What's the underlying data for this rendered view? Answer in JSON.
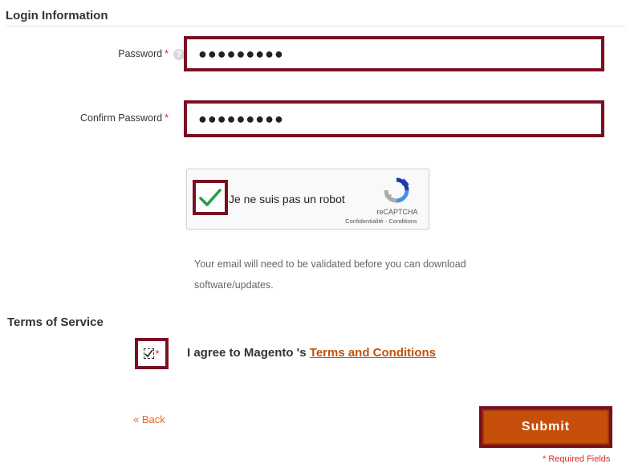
{
  "login": {
    "title": "Login Information",
    "password_label": "Password",
    "password_value": "●●●●●●●●●",
    "confirm_label": "Confirm Password",
    "confirm_value": "●●●●●●●●●",
    "required_star": "*",
    "help_glyph": "?"
  },
  "captcha": {
    "label": "Je ne suis pas un robot",
    "brand": "reCAPTCHA",
    "links": "Confidentialité - Conditions",
    "checked": true
  },
  "note": {
    "line1": "Your email will need to be validated before you can download",
    "line2": "software/updates."
  },
  "terms": {
    "title": "Terms of Service",
    "agree_prefix": "I agree to Magento 's ",
    "link_text": "Terms and Conditions",
    "required_star": "*",
    "checked": true
  },
  "actions": {
    "back_label": "« Back",
    "submit_label": "Submit",
    "required_fields_note": "* Required Fields"
  },
  "colors": {
    "highlight_border": "#7a0f22",
    "submit_bg": "#c64f0b",
    "link": "#c0510a",
    "required": "#e02b27"
  }
}
